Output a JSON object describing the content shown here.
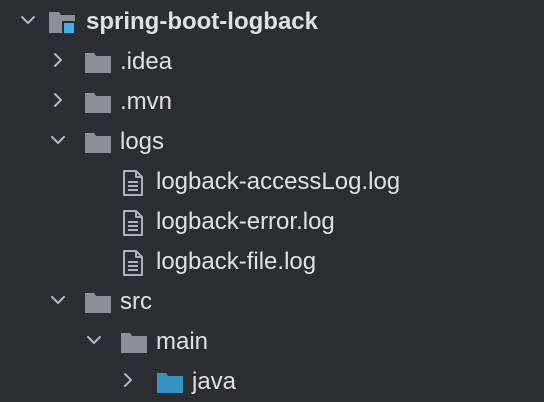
{
  "project_tree": {
    "root": {
      "label": "spring-boot-logback",
      "expanded": true,
      "icon": "module-folder-icon"
    },
    "items": [
      {
        "label": ".idea",
        "expanded": false,
        "icon": "folder-icon"
      },
      {
        "label": ".mvn",
        "expanded": false,
        "icon": "folder-icon"
      },
      {
        "label": "logs",
        "expanded": true,
        "icon": "folder-icon"
      },
      {
        "label": "logback-accessLog.log",
        "icon": "log-file-icon"
      },
      {
        "label": "logback-error.log",
        "icon": "log-file-icon"
      },
      {
        "label": "logback-file.log",
        "icon": "log-file-icon"
      },
      {
        "label": "src",
        "expanded": true,
        "icon": "folder-icon"
      },
      {
        "label": "main",
        "expanded": true,
        "icon": "folder-icon"
      },
      {
        "label": "java",
        "expanded": false,
        "icon": "source-folder-icon"
      }
    ]
  },
  "colors": {
    "background": "#2b2d30",
    "text": "#dfe1e5",
    "folder": "#8c9094",
    "source_folder": "#3592c4",
    "module_badge": "#3fb1e6",
    "chevron": "#b4b8bf"
  }
}
